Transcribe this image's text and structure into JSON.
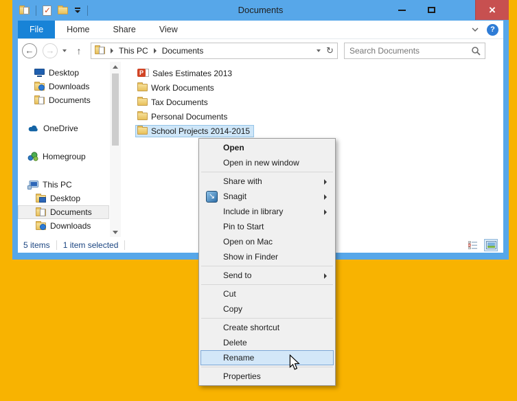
{
  "titlebar": {
    "title": "Documents"
  },
  "ribbon": {
    "tabs": [
      {
        "label": "File",
        "active": true
      },
      {
        "label": "Home",
        "active": false
      },
      {
        "label": "Share",
        "active": false
      },
      {
        "label": "View",
        "active": false
      }
    ]
  },
  "address_bar": {
    "breadcrumb": [
      "This PC",
      "Documents"
    ],
    "search_placeholder": "Search Documents"
  },
  "sidebar": {
    "items": [
      {
        "label": "Desktop",
        "icon": "monitor-icon"
      },
      {
        "label": "Downloads",
        "icon": "folder-download-icon"
      },
      {
        "label": "Documents",
        "icon": "folder-document-icon"
      },
      {
        "label": "OneDrive",
        "icon": "onedrive-cloud-icon"
      },
      {
        "label": "Homegroup",
        "icon": "homegroup-icon"
      },
      {
        "label": "This PC",
        "icon": "computer-icon"
      },
      {
        "label": "Desktop",
        "icon": "folder-monitor-icon"
      },
      {
        "label": "Documents",
        "icon": "folder-document-icon",
        "selected": true
      },
      {
        "label": "Downloads",
        "icon": "folder-download-icon"
      }
    ]
  },
  "files": [
    {
      "name": "Sales Estimates 2013",
      "icon": "powerpoint-file-icon",
      "selected": false
    },
    {
      "name": "Work Documents",
      "icon": "folder-icon",
      "selected": false
    },
    {
      "name": "Tax Documents",
      "icon": "folder-icon",
      "selected": false
    },
    {
      "name": "Personal Documents",
      "icon": "folder-icon",
      "selected": false
    },
    {
      "name": "School Projects 2014-2015",
      "icon": "folder-icon",
      "selected": true
    }
  ],
  "context_menu": {
    "items": [
      {
        "label": "Open",
        "bold": true
      },
      {
        "label": "Open in new window"
      },
      {
        "label": "Share with",
        "submenu": true
      },
      {
        "label": "Snagit",
        "submenu": true,
        "icon": "snagit-icon"
      },
      {
        "label": "Include in library",
        "submenu": true
      },
      {
        "label": "Pin to Start"
      },
      {
        "label": "Open on Mac"
      },
      {
        "label": "Show in Finder"
      },
      {
        "label": "Send to",
        "submenu": true
      },
      {
        "label": "Cut"
      },
      {
        "label": "Copy"
      },
      {
        "label": "Create shortcut"
      },
      {
        "label": "Delete"
      },
      {
        "label": "Rename",
        "highlighted": true
      },
      {
        "label": "Properties"
      }
    ]
  },
  "status_bar": {
    "items_count": "5 items",
    "selection_count": "1 item selected"
  },
  "glyphs": {
    "back": "←",
    "forward": "→",
    "up": "↑",
    "refresh": "↻",
    "help": "?",
    "close": "×",
    "check": "✓",
    "ppt_letter": "P",
    "snagit": "↘"
  },
  "colors": {
    "desktop_background": "#F8B301",
    "window_chrome": "#57A7E9",
    "file_tab": "#1883D7",
    "close_button": "#C75050",
    "file_selection_fill": "#CEE6F8",
    "file_selection_border": "#94C4E8",
    "menu_highlight_fill": "#D3E7F8",
    "menu_highlight_border": "#7BA7D7",
    "status_text": "#1A4480"
  }
}
